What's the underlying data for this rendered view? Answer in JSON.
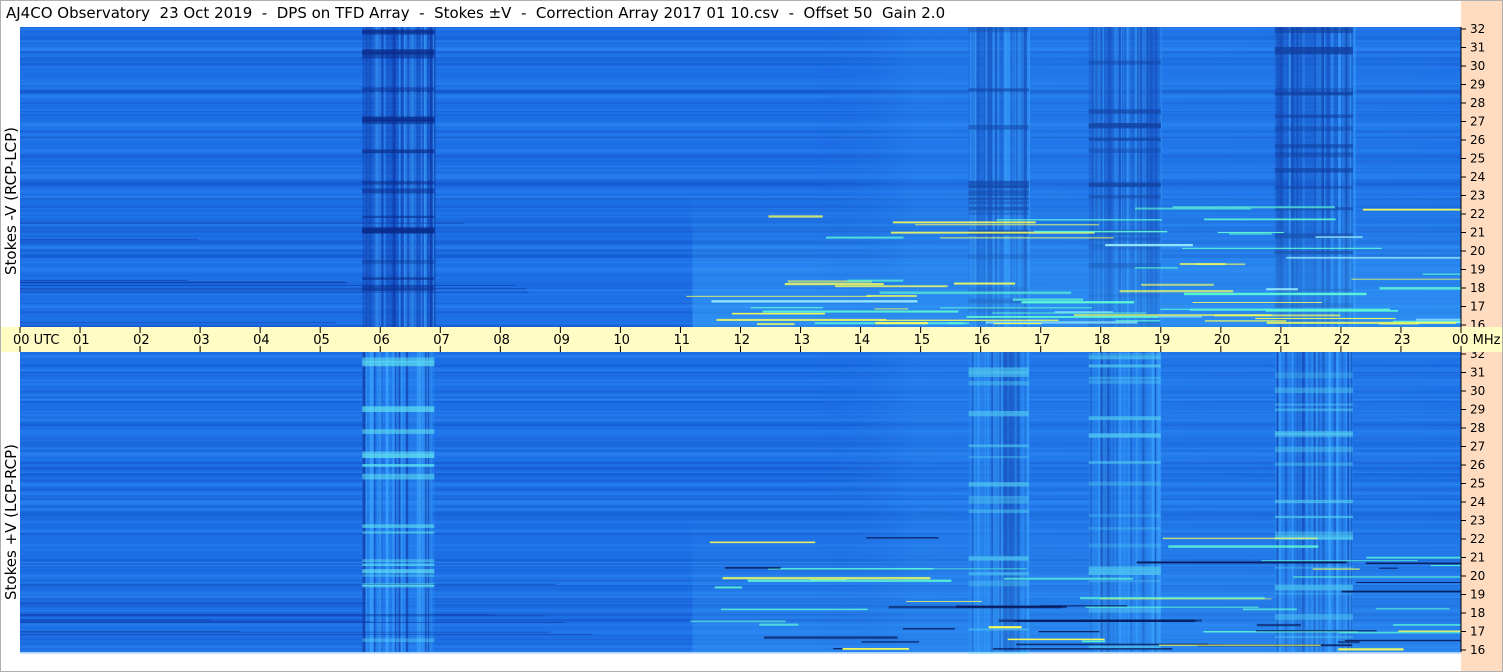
{
  "title": "AJ4CO Observatory  23 Oct 2019  -  DPS on TFD Array  -  Stokes ±V  -  Correction Array 2017 01 10.csv  -  Offset 50  Gain 2.0",
  "colors": {
    "background_field": "#1d6fe6",
    "time_axis_band": "#fffcc4",
    "freq_axis_band": "#ffdcc0",
    "bright_feature": "#5df7d6",
    "hot_feature": "#f8ff5a",
    "dark_feature": "#071a5a"
  },
  "chart_data": [
    {
      "type": "heatmap",
      "panel": "top",
      "ylabel": "Stokes -V (RCP-LCP)",
      "x_ticks": [
        "00 UTC",
        "01",
        "02",
        "03",
        "04",
        "05",
        "06",
        "07",
        "08",
        "09",
        "10",
        "11",
        "12",
        "13",
        "14",
        "15",
        "16",
        "17",
        "18",
        "19",
        "20",
        "21",
        "22",
        "23",
        "00 MHz"
      ],
      "y_ticks": [
        "32",
        "31",
        "30",
        "29",
        "28",
        "27",
        "26",
        "25",
        "24",
        "23",
        "22",
        "21",
        "20",
        "19",
        "18",
        "17",
        "16"
      ],
      "xlim_hours_utc": [
        0,
        24
      ],
      "ylim_mhz": [
        16,
        32
      ],
      "grid": false
    },
    {
      "type": "heatmap",
      "panel": "bottom",
      "ylabel": "Stokes +V (LCP-RCP)",
      "x_ticks": [
        "00 UTC",
        "01",
        "02",
        "03",
        "04",
        "05",
        "06",
        "07",
        "08",
        "09",
        "10",
        "11",
        "12",
        "13",
        "14",
        "15",
        "16",
        "17",
        "18",
        "19",
        "20",
        "21",
        "22",
        "23",
        "00 MHz"
      ],
      "y_ticks": [
        "32",
        "31",
        "30",
        "29",
        "28",
        "27",
        "26",
        "25",
        "24",
        "23",
        "22",
        "21",
        "20",
        "19",
        "18",
        "17",
        "16"
      ],
      "xlim_hours_utc": [
        0,
        24
      ],
      "ylim_mhz": [
        16,
        32
      ],
      "grid": false
    }
  ]
}
